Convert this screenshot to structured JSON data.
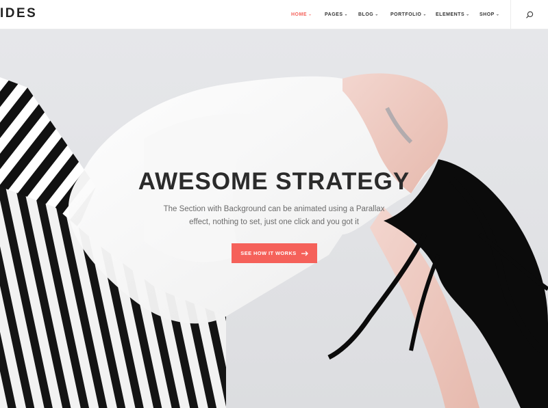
{
  "header": {
    "logo_text": "IDES",
    "nav": [
      {
        "label": "HOME",
        "active": true
      },
      {
        "label": "PAGES",
        "active": false
      },
      {
        "label": "BLOG",
        "active": false
      },
      {
        "label": "PORTFOLIO",
        "active": false
      },
      {
        "label": "ELEMENTS",
        "active": false
      },
      {
        "label": "SHOP",
        "active": false
      }
    ],
    "dropdown_icon": "chevron-down-icon",
    "search_icon": "search-icon"
  },
  "hero": {
    "title": "AWESOME STRATEGY",
    "subtitle": "The Section with Background can be animated using a Parallax effect, nothing to set, just one click and you got it",
    "cta_label": "SEE HOW IT WORKS",
    "cta_icon": "arrow-right-icon",
    "image": "dancer-in-striped-pants-photo"
  },
  "colors": {
    "accent": "#f5615a",
    "text_dark": "#2b2b2b",
    "text_muted": "#6b6b6b",
    "background_hero": "#e3e4e7"
  }
}
